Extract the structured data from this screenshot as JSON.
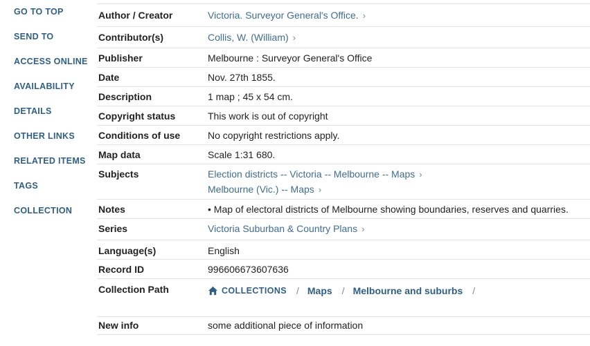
{
  "side_nav": [
    {
      "label": "GO TO TOP"
    },
    {
      "label": "SEND TO"
    },
    {
      "label": "ACCESS ONLINE"
    },
    {
      "label": "AVAILABILITY"
    },
    {
      "label": "DETAILS"
    },
    {
      "label": "OTHER LINKS"
    },
    {
      "label": "RELATED ITEMS"
    },
    {
      "label": "TAGS"
    },
    {
      "label": "COLLECTION"
    }
  ],
  "details": {
    "author_label": "Author / Creator",
    "author_value": "Victoria. Surveyor General's Office.",
    "contributor_label": "Contributor(s)",
    "contributor_value": "Collis, W. (William)",
    "publisher_label": "Publisher",
    "publisher_value": "Melbourne : Surveyor General's Office",
    "date_label": "Date",
    "date_value": "Nov. 27th 1855.",
    "description_label": "Description",
    "description_value": "1 map ; 45 x 54 cm.",
    "copyright_label": "Copyright status",
    "copyright_value": "This work is out of copyright",
    "conditions_label": "Conditions of use",
    "conditions_value": "No copyright restrictions apply.",
    "mapdata_label": "Map data",
    "mapdata_value": "Scale 1:31 680.",
    "subjects_label": "Subjects",
    "subjects": [
      "Election districts -- Victoria -- Melbourne -- Maps",
      "Melbourne (Vic.) -- Maps"
    ],
    "notes_label": "Notes",
    "notes_value": "• Map of electoral districts of Melbourne showing boundaries, reserves and quarries.",
    "series_label": "Series",
    "series_value": "Victoria Suburban & Country Plans",
    "language_label": "Language(s)",
    "language_value": "English",
    "recordid_label": "Record ID",
    "recordid_value": "996606673607636",
    "collection_path_label": "Collection Path",
    "collection_path": {
      "home": "COLLECTIONS",
      "crumb1": "Maps",
      "crumb2": "Melbourne and suburbs",
      "separator": "/"
    },
    "newinfo_label": "New info",
    "newinfo_value": "some additional piece of information"
  },
  "colors": {
    "link": "#3d6d94",
    "nav": "#2f5f86",
    "divider": "#e2e2e2"
  },
  "icons": {
    "chevron": "chevron-right-icon",
    "home": "home-icon"
  }
}
